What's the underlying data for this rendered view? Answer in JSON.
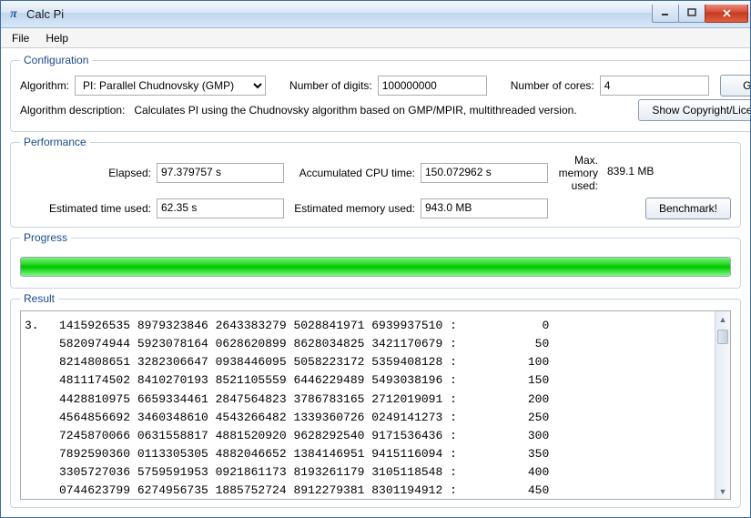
{
  "window": {
    "title": "Calc Pi"
  },
  "menu": {
    "file": "File",
    "help": "Help"
  },
  "config": {
    "legend": "Configuration",
    "algorithm_label": "Algorithm:",
    "algorithm_value": "PI: Parallel Chudnovsky (GMP)",
    "digits_label": "Number of digits:",
    "digits_value": "100000000",
    "cores_label": "Number of cores:",
    "cores_value": "4",
    "go_label": "Go!",
    "desc_label": "Algorithm description:",
    "desc_value": "Calculates PI using the Chudnovsky algorithm based on GMP/MPIR, multithreaded version.",
    "license_label": "Show Copyright/License"
  },
  "perf": {
    "legend": "Performance",
    "elapsed_label": "Elapsed:",
    "elapsed_value": "97.379757 s",
    "cpu_label": "Accumulated CPU time:",
    "cpu_value": "150.072962 s",
    "maxmem_label": "Max. memory used:",
    "maxmem_value": "839.1 MB",
    "est_time_label": "Estimated time used:",
    "est_time_value": "62.35 s",
    "est_mem_label": "Estimated memory used:",
    "est_mem_value": "943.0 MB",
    "benchmark_label": "Benchmark!"
  },
  "progress": {
    "legend": "Progress",
    "percent": 100
  },
  "result": {
    "legend": "Result",
    "leading": "3.",
    "rows": [
      {
        "d": "1415926535 8979323846 2643383279 5028841971 6939937510",
        "i": "0"
      },
      {
        "d": "5820974944 5923078164 0628620899 8628034825 3421170679",
        "i": "50"
      },
      {
        "d": "8214808651 3282306647 0938446095 5058223172 5359408128",
        "i": "100"
      },
      {
        "d": "4811174502 8410270193 8521105559 6446229489 5493038196",
        "i": "150"
      },
      {
        "d": "4428810975 6659334461 2847564823 3786783165 2712019091",
        "i": "200"
      },
      {
        "d": "4564856692 3460348610 4543266482 1339360726 0249141273",
        "i": "250"
      },
      {
        "d": "7245870066 0631558817 4881520920 9628292540 9171536436",
        "i": "300"
      },
      {
        "d": "7892590360 0113305305 4882046652 1384146951 9415116094",
        "i": "350"
      },
      {
        "d": "3305727036 5759591953 0921861173 8193261179 3105118548",
        "i": "400"
      },
      {
        "d": "0744623799 6274956735 1885752724 8912279381 8301194912",
        "i": "450"
      }
    ]
  }
}
